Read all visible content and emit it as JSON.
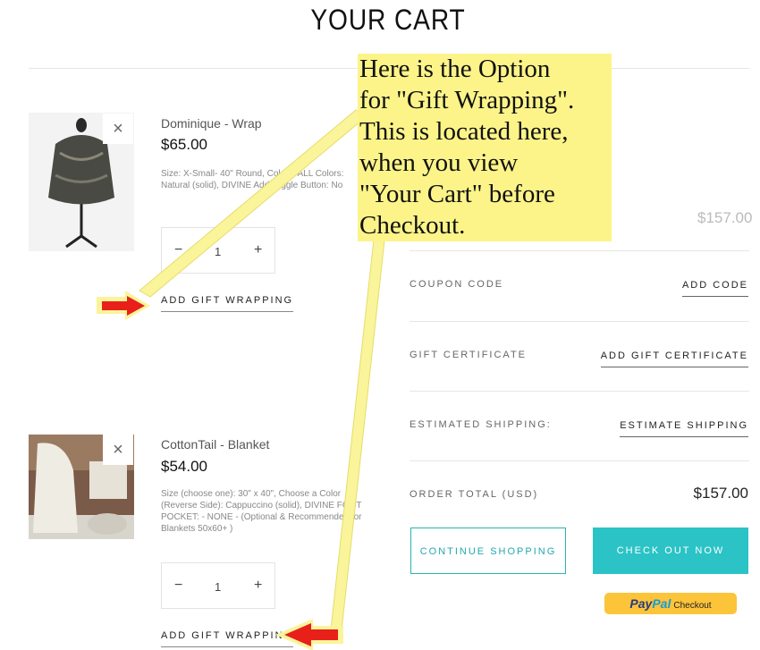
{
  "page_title": "YOUR CART",
  "items": [
    {
      "name": "Dominique - Wrap",
      "price": "$65.00",
      "options": "Size: X-Small- 40\" Round, Colors, ALL Colors: Natural (solid), DIVINE Add Toggle Button: No",
      "quantity": "1",
      "gift_link": "ADD GIFT WRAPPING"
    },
    {
      "name": "CottonTail - Blanket",
      "price": "$54.00",
      "options": "Size (choose one): 30\" x 40\", Choose a Color (Reverse Side): Cappuccino (solid), DIVINE FOOT POCKET: - NONE - (Optional & Recommended for Blankets 50x60+ )",
      "quantity": "1",
      "gift_link": "ADD GIFT WRAPPING"
    }
  ],
  "qty_minus": "−",
  "qty_plus": "+",
  "remove_symbol": "×",
  "summary": {
    "subtotal_value": "$157.00",
    "coupon_label": "COUPON CODE",
    "coupon_link": "ADD CODE",
    "gift_cert_label": "GIFT CERTIFICATE",
    "gift_cert_link": "ADD GIFT CERTIFICATE",
    "shipping_label": "ESTIMATED SHIPPING:",
    "shipping_link": "ESTIMATE SHIPPING",
    "total_label": "ORDER TOTAL (USD)",
    "total_value": "$157.00"
  },
  "buttons": {
    "continue": "CONTINUE SHOPPING",
    "checkout": "CHECK OUT NOW",
    "paypal_pay": "Pay",
    "paypal_pal": "Pal",
    "paypal_checkout": "Checkout"
  },
  "annotation": {
    "lines": [
      "Here is the Option",
      "for \"Gift Wrapping\".",
      "This is located here,",
      "when you view",
      "\"Your Cart\" before",
      "Checkout."
    ],
    "note_color": "#fcf489",
    "arrow_color": "#e8201a",
    "pointer_color": "#faf49a"
  },
  "colors": {
    "accent": "#2bc3c6"
  }
}
